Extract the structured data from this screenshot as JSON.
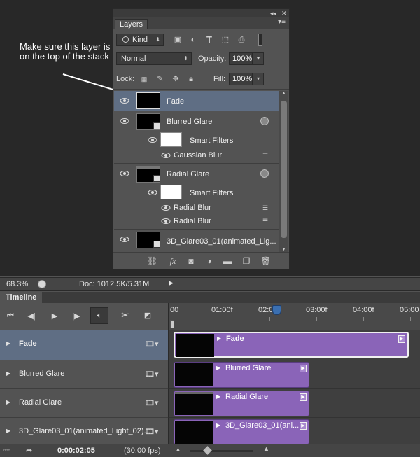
{
  "annotation": {
    "text": "Make sure this layer is on the top of the stack"
  },
  "layers_panel": {
    "tab": "Layers",
    "controls": {
      "collapse": "◂◂",
      "close": "✕",
      "menu": "▾≡"
    },
    "filter": {
      "kind_label": "Kind",
      "icons": [
        "image-filter-icon",
        "adjustment-filter-icon",
        "type-filter-icon",
        "shape-filter-icon",
        "smart-object-filter-icon"
      ]
    },
    "blend_mode": "Normal",
    "opacity_label": "Opacity:",
    "opacity_value": "100%",
    "lock_label": "Lock:",
    "fill_label": "Fill:",
    "fill_value": "100%",
    "layers": [
      {
        "name": "Fade",
        "selected": true
      },
      {
        "name": "Blurred Glare",
        "smart_filters_label": "Smart Filters",
        "filters": [
          "Gaussian Blur"
        ]
      },
      {
        "name": "Radial Glare",
        "smart_filters_label": "Smart Filters",
        "filters": [
          "Radial Blur",
          "Radial Blur"
        ]
      },
      {
        "name": "3D_Glare03_01(animated_Lig..."
      }
    ],
    "footer_icons": [
      "link-icon",
      "fx-icon",
      "mask-icon",
      "adjustment-icon",
      "folder-icon",
      "new-layer-icon",
      "trash-icon"
    ]
  },
  "status_bar": {
    "zoom": "68.3%",
    "doc": "Doc: 1012.5K/5.31M"
  },
  "timeline": {
    "tab": "Timeline",
    "ruler": [
      "00",
      "01:00f",
      "02:0",
      "03:00f",
      "04:00f",
      "05:00"
    ],
    "tracks": [
      {
        "label": "Fade",
        "clip": "Fade",
        "selected": true
      },
      {
        "label": "Blurred Glare",
        "clip": "Blurred Glare"
      },
      {
        "label": "Radial Glare",
        "clip": "Radial Glare"
      },
      {
        "label": "3D_Glare03_01(animated_Light_02)...",
        "clip": "3D_Glare03_01(ani..."
      }
    ],
    "time_code": "0:00:02:05",
    "fps": "(30.00 fps)"
  },
  "colors": {
    "selected_row": "#5f6e84",
    "clip": "#8a64b8",
    "playhead": "#e0303a",
    "canvas": "#282828"
  }
}
